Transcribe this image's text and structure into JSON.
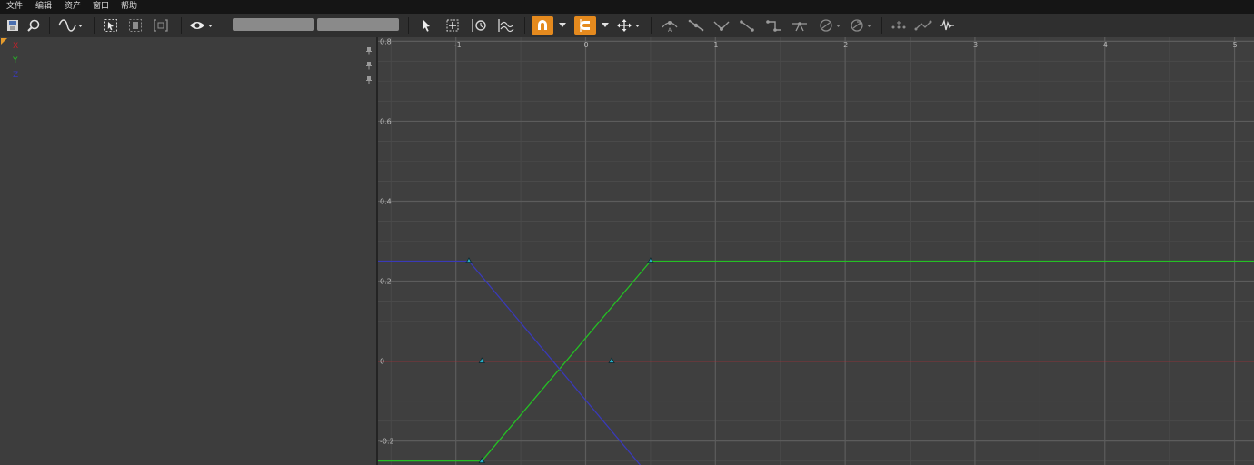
{
  "menu": [
    "文件",
    "编辑",
    "资产",
    "窗口",
    "帮助"
  ],
  "toolbar": {
    "icons": [
      "save-icon",
      "browse-icon",
      "curve-mode-icon",
      "select-icon",
      "key-icon",
      "frame-icon",
      "visibility-icon",
      "pointer-icon",
      "zoom-fit-icon",
      "time-icon",
      "normalize-icon",
      "snap-value-icon",
      "snap-time-icon",
      "transform-icon",
      "tangent-auto-icon",
      "tangent-user-icon",
      "tangent-break-icon",
      "tangent-linear-icon",
      "tangent-constant-icon",
      "flatten-icon",
      "pre-infinity-icon",
      "post-infinity-icon",
      "bake-icon",
      "reduce-icon",
      "filter-icon"
    ],
    "input_value_1": "",
    "input_value_2": ""
  },
  "curves": [
    {
      "label": "X",
      "color": "#c8202a"
    },
    {
      "label": "Y",
      "color": "#24c024"
    },
    {
      "label": "Z",
      "color": "#3a3ab8"
    }
  ],
  "chart_data": {
    "type": "line",
    "title": "",
    "xlabel": "",
    "ylabel": "",
    "xlim": [
      -1.6,
      5.15
    ],
    "ylim": [
      -0.26,
      0.81
    ],
    "x_ticks": [
      -1,
      0,
      1,
      2,
      3,
      4,
      5
    ],
    "y_ticks": [
      0.8,
      0.6,
      0.4,
      0.2,
      0,
      -0.2
    ],
    "grid": true,
    "series": [
      {
        "name": "X",
        "color": "#c8202a",
        "points": [
          [
            -1.6,
            0
          ],
          [
            -0.8,
            0
          ],
          [
            0.2,
            0
          ],
          [
            5.15,
            0
          ]
        ],
        "keys": [
          [
            -0.8,
            0
          ],
          [
            0.2,
            0
          ]
        ]
      },
      {
        "name": "Y",
        "color": "#24c024",
        "points": [
          [
            -1.6,
            -0.25
          ],
          [
            -0.8,
            -0.25
          ],
          [
            0.5,
            0.25
          ],
          [
            5.15,
            0.25
          ]
        ],
        "keys": [
          [
            -0.8,
            -0.25
          ],
          [
            0.5,
            0.25
          ]
        ]
      },
      {
        "name": "Z",
        "color": "#3a3ab8",
        "points": [
          [
            -1.6,
            0.25
          ],
          [
            -0.9,
            0.25
          ],
          [
            0.42,
            -0.26
          ]
        ],
        "keys": [
          [
            -0.9,
            0.25
          ]
        ]
      }
    ]
  }
}
